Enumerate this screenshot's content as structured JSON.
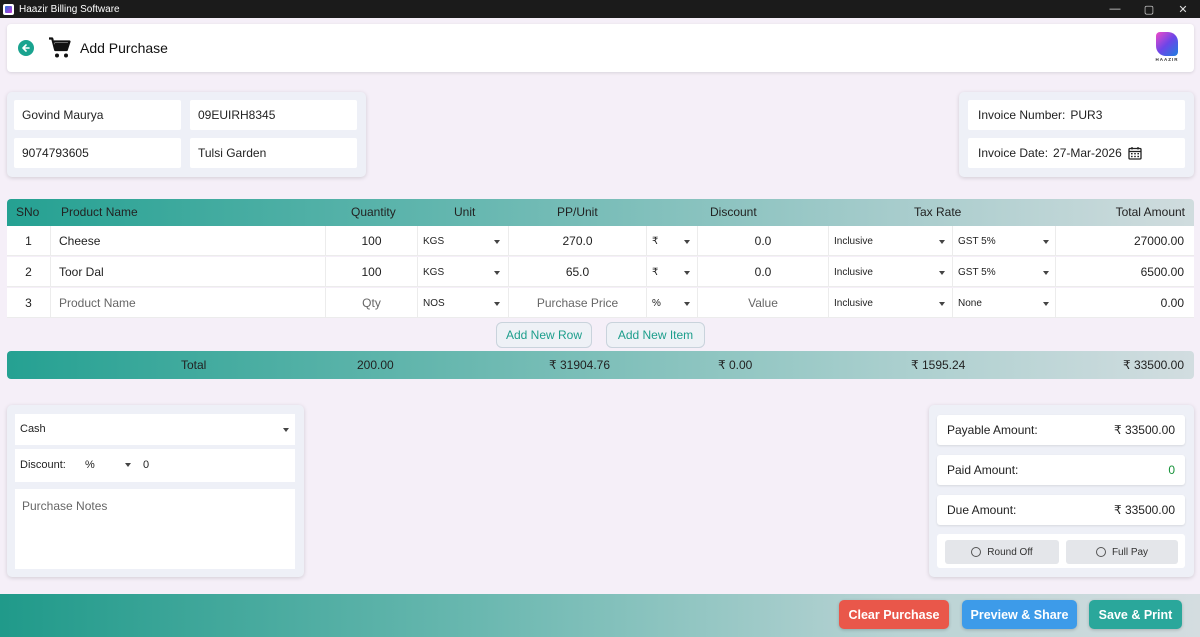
{
  "window": {
    "title": "Haazir Billing Software",
    "controls": [
      "—",
      "▢",
      "✕"
    ]
  },
  "header": {
    "page_title": "Add Purchase",
    "logo_text": "HAAZIR"
  },
  "supplier": {
    "name": "Govind Maurya",
    "gstin": "09EUIRH8345",
    "phone": "9074793605",
    "address": "Tulsi Garden"
  },
  "invoice": {
    "number_label": "Invoice Number:",
    "number": "PUR3",
    "date_label": "Invoice Date:",
    "date": "27-Mar-2026"
  },
  "table": {
    "headers": [
      "SNo",
      "Product Name",
      "Quantity",
      "Unit",
      "PP/Unit",
      "Discount",
      "Tax Rate",
      "Total Amount"
    ],
    "rows": [
      {
        "sno": "1",
        "product": "Cheese",
        "qty": "100",
        "unit": "KGS",
        "pp": "270.0",
        "disc_type": "₹",
        "disc": "0.0",
        "tax_mode": "Inclusive",
        "tax": "GST 5%",
        "total": "27000.00"
      },
      {
        "sno": "2",
        "product": "Toor Dal",
        "qty": "100",
        "unit": "KGS",
        "pp": "65.0",
        "disc_type": "₹",
        "disc": "0.0",
        "tax_mode": "Inclusive",
        "tax": "GST 5%",
        "total": "6500.00"
      },
      {
        "sno": "3",
        "product": "Product Name",
        "qty": "Qty",
        "unit": "NOS",
        "pp": "Purchase Price",
        "disc_type": "%",
        "disc": "Value",
        "tax_mode": "Inclusive",
        "tax": "None",
        "total": "0.00"
      }
    ],
    "add_row_label": "Add New Row",
    "add_item_label": "Add New Item"
  },
  "totals": {
    "label": "Total",
    "qty": "200.00",
    "pp": "₹ 31904.76",
    "discount": "₹ 0.00",
    "tax": "₹ 1595.24",
    "amount": "₹ 33500.00"
  },
  "payment": {
    "mode": "Cash",
    "discount_label": "Discount:",
    "discount_type": "%",
    "discount_value": "0",
    "notes_placeholder": "Purchase Notes"
  },
  "summary": {
    "payable_label": "Payable Amount:",
    "payable": "₹ 33500.00",
    "paid_label": "Paid Amount:",
    "paid": "0",
    "due_label": "Due Amount:",
    "due": "₹ 33500.00",
    "round_off_label": "Round Off",
    "full_pay_label": "Full Pay"
  },
  "footer": {
    "clear_label": "Clear Purchase",
    "preview_label": "Preview & Share",
    "save_label": "Save & Print"
  },
  "colors": {
    "accent": "#1aa38f",
    "clear": "#e9574a",
    "preview": "#3d9be9",
    "save": "#2aa79b",
    "paid": "#17923a"
  }
}
